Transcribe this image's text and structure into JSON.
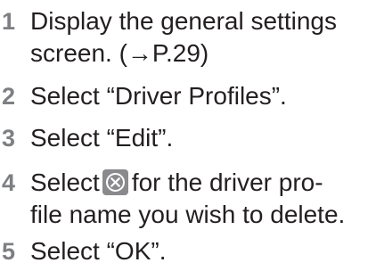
{
  "steps": [
    {
      "number": "1",
      "lines": [
        "Display the general settings",
        "screen. (→P.29)"
      ]
    },
    {
      "number": "2",
      "lines": [
        "Select “Driver Profiles”."
      ]
    },
    {
      "number": "3",
      "lines": [
        "Select “Edit”."
      ]
    },
    {
      "number": "4",
      "line1_before_icon": "Select",
      "line1_after_icon": "for the driver pro-",
      "line2": "file name you wish to delete.",
      "icon": "delete-circle-x-icon"
    },
    {
      "number": "5",
      "lines": [
        "Select “OK”."
      ]
    }
  ],
  "colors": {
    "step_number": "#7d7f82",
    "text": "#231f20",
    "icon_background": "#8a8a8d",
    "icon_glyph": "#ffffff"
  }
}
